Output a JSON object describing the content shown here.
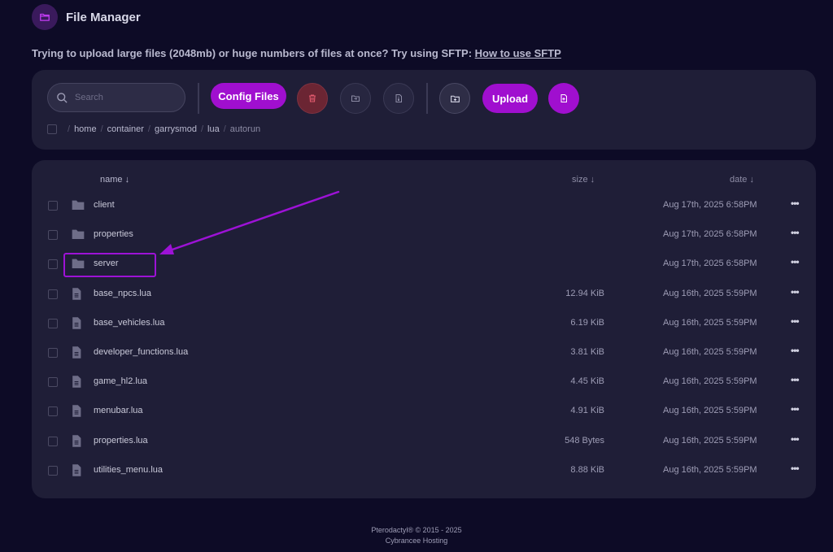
{
  "header": {
    "title": "File Manager",
    "icon": "folder-open-icon"
  },
  "notice": {
    "text": "Trying to upload large files (2048mb) or huge numbers of files at once? Try using SFTP: ",
    "link": "How to use SFTP"
  },
  "toolbar": {
    "search_placeholder": "Search",
    "config_files_label": "Config Files",
    "upload_label": "Upload",
    "icons": [
      "trash-icon",
      "folder-move-icon",
      "file-archive-icon",
      "new-folder-icon",
      "new-file-icon"
    ]
  },
  "breadcrumb": {
    "segments": [
      "home",
      "container",
      "garrysmod",
      "lua",
      "autorun"
    ]
  },
  "table": {
    "headers": {
      "name": "name ↓",
      "size": "size ↓",
      "date": "date ↓"
    },
    "rows": [
      {
        "type": "folder",
        "name": "client",
        "size": "",
        "date": "Aug 17th, 2025 6:58PM"
      },
      {
        "type": "folder",
        "name": "properties",
        "size": "",
        "date": "Aug 17th, 2025 6:58PM"
      },
      {
        "type": "folder",
        "name": "server",
        "size": "",
        "date": "Aug 17th, 2025 6:58PM"
      },
      {
        "type": "file",
        "name": "base_npcs.lua",
        "size": "12.94 KiB",
        "date": "Aug 16th, 2025 5:59PM"
      },
      {
        "type": "file",
        "name": "base_vehicles.lua",
        "size": "6.19 KiB",
        "date": "Aug 16th, 2025 5:59PM"
      },
      {
        "type": "file",
        "name": "developer_functions.lua",
        "size": "3.81 KiB",
        "date": "Aug 16th, 2025 5:59PM"
      },
      {
        "type": "file",
        "name": "game_hl2.lua",
        "size": "4.45 KiB",
        "date": "Aug 16th, 2025 5:59PM"
      },
      {
        "type": "file",
        "name": "menubar.lua",
        "size": "4.91 KiB",
        "date": "Aug 16th, 2025 5:59PM"
      },
      {
        "type": "file",
        "name": "properties.lua",
        "size": "548 Bytes",
        "date": "Aug 16th, 2025 5:59PM"
      },
      {
        "type": "file",
        "name": "utilities_menu.lua",
        "size": "8.88 KiB",
        "date": "Aug 16th, 2025 5:59PM"
      }
    ],
    "more_label": "•••"
  },
  "footer": {
    "line1": "Pterodactyl® © 2015 - 2025",
    "line2": "Cybrancee Hosting"
  },
  "colors": {
    "accent": "#a00fcf",
    "background": "#0d0b26",
    "card": "#1f1e37",
    "annotation": "#9d12d6"
  }
}
